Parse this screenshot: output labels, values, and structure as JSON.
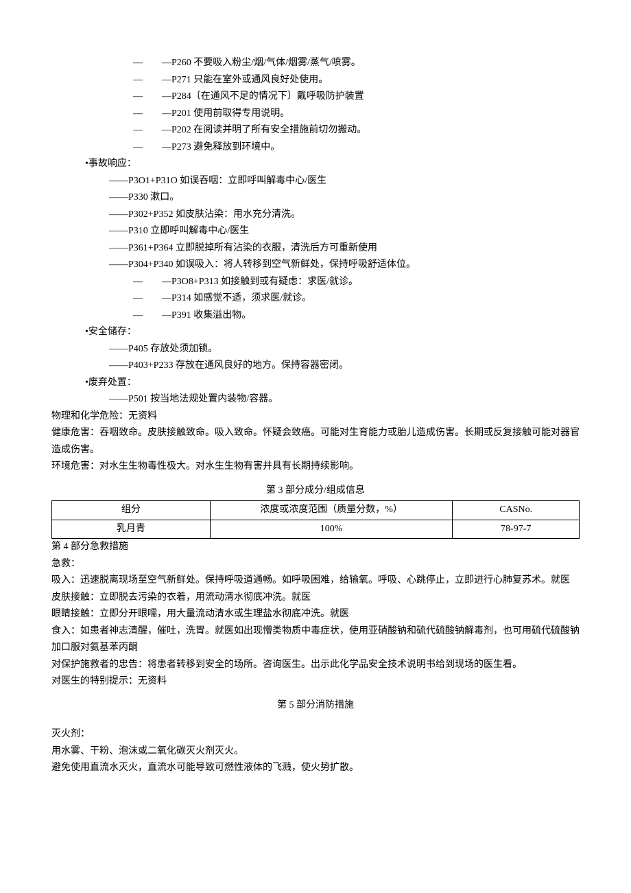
{
  "prevention": [
    "—　　—P260 不要吸入粉尘/烟/气体/烟雾/蒸气/喷雾。",
    "—　　—P271 只能在室外或通风良好处使用。",
    "—　　—P284〔在通风不足的情况下〕戴呼吸防护装置",
    "—　　—P201 使用前取得专用说明。",
    "—　　—P202 在阅读并明了所有安全措施前切勿搬动。",
    "—　　—P273 避免释放到环境中。"
  ],
  "response_title": "•事故响应：",
  "response": [
    "——P3O1+P31O 如误吞咽：立即呼叫解毒中心/医生",
    "——P330 漱口。",
    "——P302+P352 如皮肤沾染：用水充分清洗。",
    "——P310 立即呼叫解毒中心/医生",
    "——P361+P364 立即脱掉所有沾染的衣服，清洗后方可重新使用",
    "——P304+P340 如误吸入：将人转移到空气新鲜处，保持呼吸舒适体位。",
    "—　　—P3O8+P313 如接触到或有疑虑：求医/就诊。",
    "—　　—P314 如感觉不适，须求医/就诊。",
    "—　　—P391 收集溢出物。"
  ],
  "storage_title": "•安全储存：",
  "storage": [
    "——P405 存放处须加锁。",
    "——P403+P233 存放在通风良好的地方。保持容器密闭。"
  ],
  "disposal_title": "•废弃处置：",
  "disposal": [
    "——P501 按当地法规处置内装物/容器。"
  ],
  "phys_chem": "物理和化学危险：无资料",
  "health_hazard": "健康危害：吞咽致命。皮肤接触致命。吸入致命。怀疑会致癌。可能对生育能力或胎儿造成伤害。长期或反复接触可能对器官造成伤害。",
  "env_hazard": "环境危害：对水生生物毒性极大。对水生生物有害并具有长期持续影响。",
  "section3_title": "第 3 部分成分/组成信息",
  "table": {
    "headers": [
      "组分",
      "浓度或浓度范围（质量分数，%）",
      "CASNo."
    ],
    "row": [
      "乳月青",
      "100%",
      "78-97-7"
    ]
  },
  "section4_title": "第 4 部分急救措施",
  "section4": [
    "急救：",
    "吸入：迅速脱离现场至空气新鲜处。保持呼吸道通畅。如呼吸困难，给输氧。呼吸、心跳停止，立即进行心肺复苏术。就医",
    "皮肤接触：立即脱去污染的衣着，用流动清水彻底冲洗。就医",
    "眼睛接触：立即分开眼嚅，用大量流动清水或生理盐水彻底冲洗。就医",
    "食入：如患者神志清醒，催吐，洗胃。就医如出现懵类物质中毒症状，使用亚硝酸钠和硫代硫酸钠解毒剂，也可用硫代硫酸钠加口服对氨基苯丙酮",
    "对保护施救者的忠告：将患者转移到安全的场所。咨询医生。出示此化学品安全技术说明书给到现场的医生看。",
    "对医生的特别提示：无资料"
  ],
  "section5_title": "第 5 部分消防措施",
  "section5": [
    "灭火剂：",
    "用水雾、干粉、泡沫或二氧化碳灭火剂灭火。",
    "避免使用直流水灭火，直流水可能导致可燃性液体的飞溅，使火势扩散。"
  ]
}
